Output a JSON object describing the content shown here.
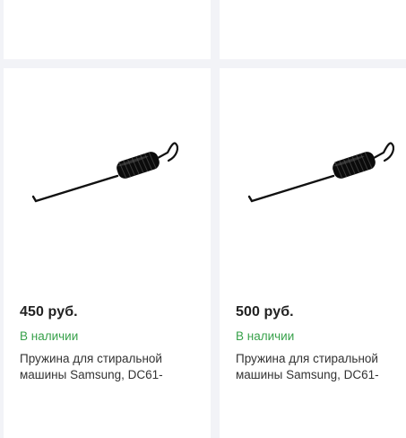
{
  "products": [
    {
      "price": "450 руб.",
      "stock": "В наличии",
      "title_line1": "Пружина для стиральной",
      "title_line2": "машины Samsung, DC61-",
      "image_icon": "spring-image"
    },
    {
      "price": "500 руб.",
      "stock": "В наличии",
      "title_line1": "Пружина для стиральной",
      "title_line2": "машины Samsung, DC61-",
      "image_icon": "spring-image"
    }
  ],
  "colors": {
    "background": "#f2f3f7",
    "card": "#ffffff",
    "stock_green": "#37a14a",
    "price_text": "#222222"
  }
}
